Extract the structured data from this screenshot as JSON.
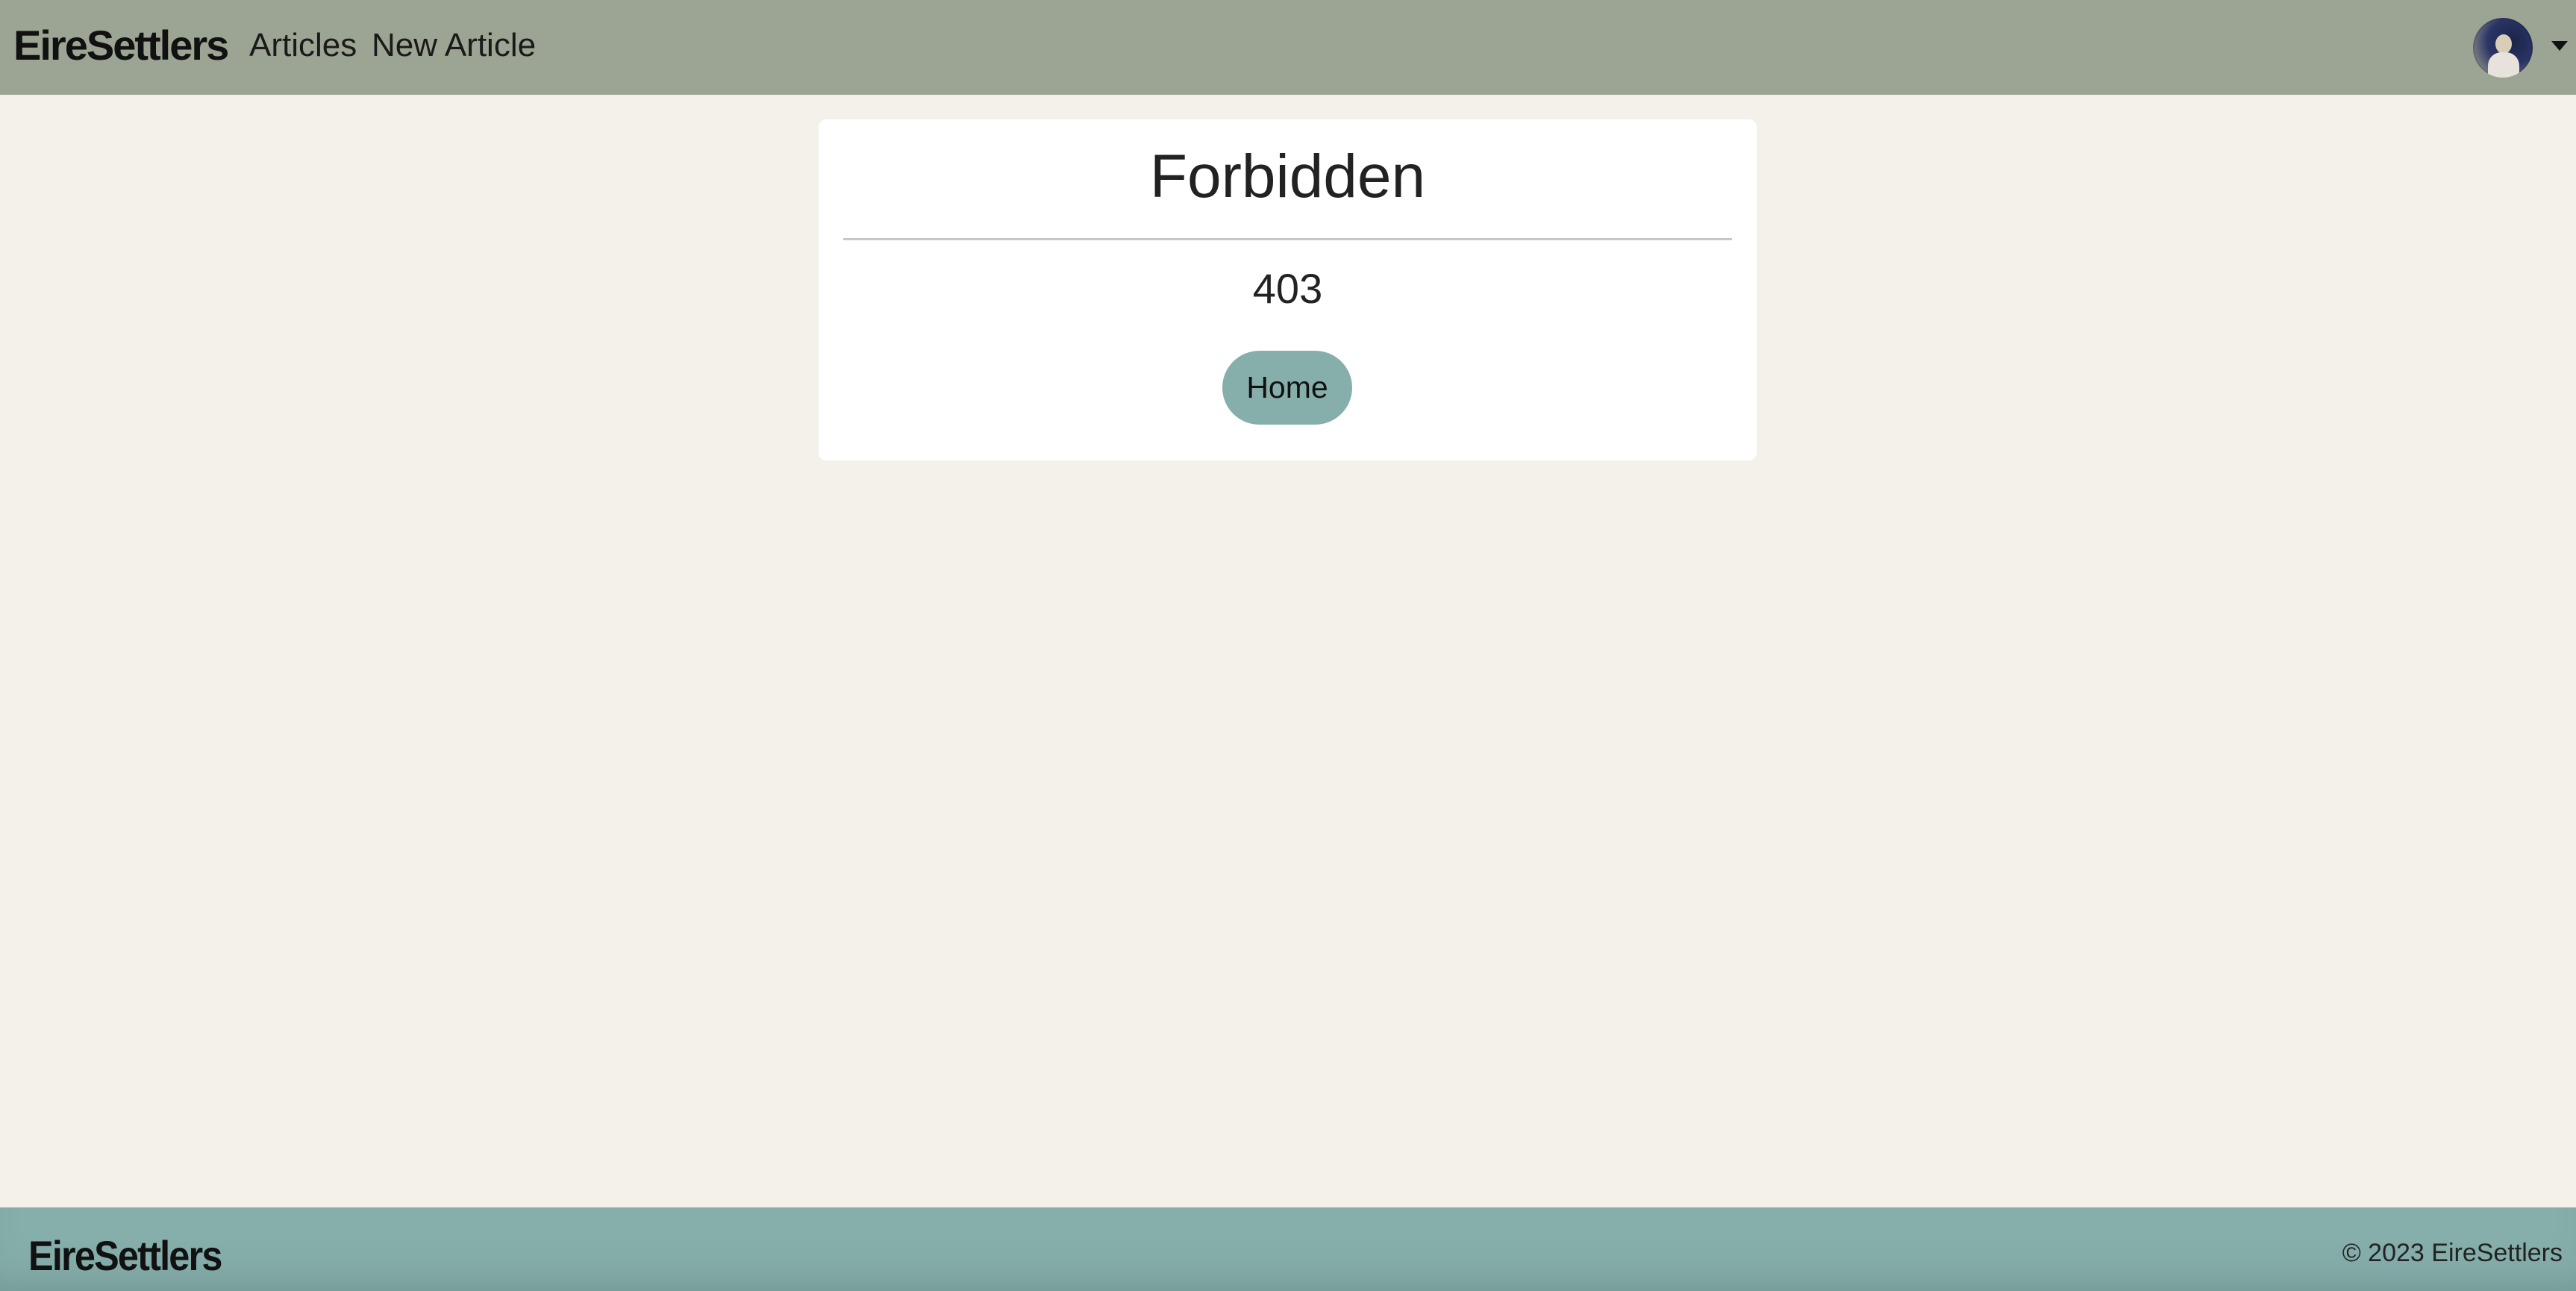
{
  "navbar": {
    "brand": "EireSettlers",
    "links": [
      {
        "label": "Articles"
      },
      {
        "label": "New Article"
      }
    ],
    "avatar_icon": "user-avatar",
    "menu_icon": "caret-down-icon"
  },
  "main": {
    "title": "Forbidden",
    "code": "403",
    "home_button_label": "Home"
  },
  "footer": {
    "brand": "EireSettlers",
    "copyright": "© 2023 EireSettlers"
  },
  "colors": {
    "navbar_bg": "#9ca593",
    "page_bg": "#f4f1ea",
    "accent": "#86aeab",
    "card_bg": "#ffffff"
  }
}
